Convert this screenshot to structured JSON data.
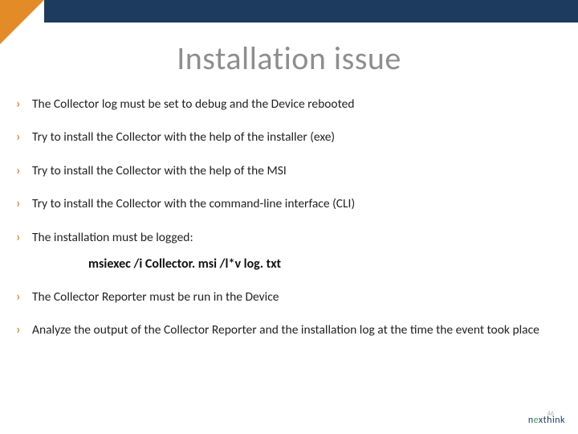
{
  "title": "Installation issue",
  "bullets": {
    "b1": "The Collector log must be set to debug and the Device rebooted",
    "b2": "Try to install the Collector with the help of the installer (exe)",
    "b3": "Try to install the Collector with the help of the MSI",
    "b4": "Try to install the Collector with the command-line interface (CLI)",
    "b5": "The installation must be logged:",
    "cmd": "msiexec /i Collector. msi /l*v log. txt",
    "b6": "The Collector Reporter must be run in the Device",
    "b7": "Analyze the output of the Collector Reporter and the installation log at the time the event took place"
  },
  "footer": {
    "brand_pre": "n",
    "brand_dot": "e",
    "brand_post": "xthink",
    "page": "46"
  }
}
